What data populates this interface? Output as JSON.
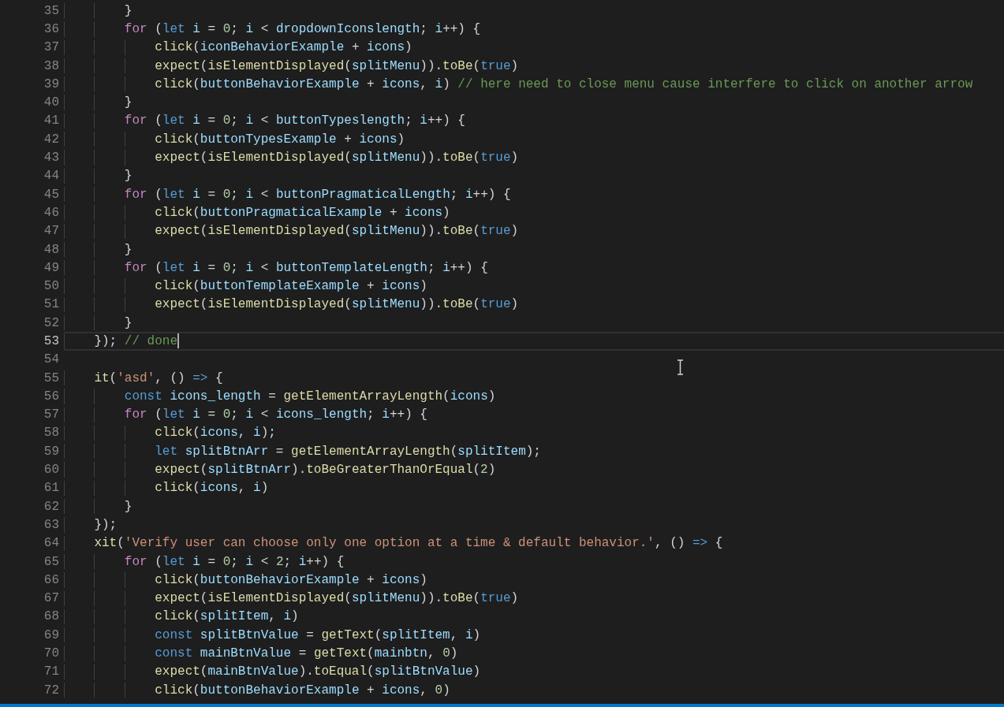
{
  "editor": {
    "lines": [
      {
        "number": "35",
        "current": false,
        "tokens": [
          {
            "kind": "plain",
            "text": "        }"
          }
        ]
      },
      {
        "number": "36",
        "current": false,
        "tokens": [
          {
            "kind": "control",
            "text": "        for"
          },
          {
            "kind": "plain",
            "text": " ("
          },
          {
            "kind": "keyword",
            "text": "let"
          },
          {
            "kind": "variable",
            "text": " i"
          },
          {
            "kind": "plain",
            "text": " = "
          },
          {
            "kind": "number",
            "text": "0"
          },
          {
            "kind": "plain",
            "text": "; "
          },
          {
            "kind": "variable",
            "text": "i"
          },
          {
            "kind": "plain",
            "text": " < "
          },
          {
            "kind": "variable",
            "text": "dropdownIconslength"
          },
          {
            "kind": "plain",
            "text": "; "
          },
          {
            "kind": "variable",
            "text": "i"
          },
          {
            "kind": "plain",
            "text": "++) {"
          }
        ]
      },
      {
        "number": "37",
        "current": false,
        "tokens": [
          {
            "kind": "function",
            "text": "            click"
          },
          {
            "kind": "plain",
            "text": "("
          },
          {
            "kind": "variable",
            "text": "iconBehaviorExample"
          },
          {
            "kind": "plain",
            "text": " + "
          },
          {
            "kind": "variable",
            "text": "icons"
          },
          {
            "kind": "plain",
            "text": ")"
          }
        ]
      },
      {
        "number": "38",
        "current": false,
        "tokens": [
          {
            "kind": "function",
            "text": "            expect"
          },
          {
            "kind": "plain",
            "text": "("
          },
          {
            "kind": "function",
            "text": "isElementDisplayed"
          },
          {
            "kind": "plain",
            "text": "("
          },
          {
            "kind": "variable",
            "text": "splitMenu"
          },
          {
            "kind": "plain",
            "text": "))."
          },
          {
            "kind": "function",
            "text": "toBe"
          },
          {
            "kind": "plain",
            "text": "("
          },
          {
            "kind": "keyword",
            "text": "true"
          },
          {
            "kind": "plain",
            "text": ")"
          }
        ]
      },
      {
        "number": "39",
        "current": false,
        "tokens": [
          {
            "kind": "function",
            "text": "            click"
          },
          {
            "kind": "plain",
            "text": "("
          },
          {
            "kind": "variable",
            "text": "buttonBehaviorExample"
          },
          {
            "kind": "plain",
            "text": " + "
          },
          {
            "kind": "variable",
            "text": "icons"
          },
          {
            "kind": "plain",
            "text": ", "
          },
          {
            "kind": "variable",
            "text": "i"
          },
          {
            "kind": "plain",
            "text": ") "
          },
          {
            "kind": "comment",
            "text": "// here need to close menu cause interfere to click on another arrow"
          }
        ]
      },
      {
        "number": "40",
        "current": false,
        "tokens": [
          {
            "kind": "plain",
            "text": "        }"
          }
        ]
      },
      {
        "number": "41",
        "current": false,
        "tokens": [
          {
            "kind": "control",
            "text": "        for"
          },
          {
            "kind": "plain",
            "text": " ("
          },
          {
            "kind": "keyword",
            "text": "let"
          },
          {
            "kind": "variable",
            "text": " i"
          },
          {
            "kind": "plain",
            "text": " = "
          },
          {
            "kind": "number",
            "text": "0"
          },
          {
            "kind": "plain",
            "text": "; "
          },
          {
            "kind": "variable",
            "text": "i"
          },
          {
            "kind": "plain",
            "text": " < "
          },
          {
            "kind": "variable",
            "text": "buttonTypeslength"
          },
          {
            "kind": "plain",
            "text": "; "
          },
          {
            "kind": "variable",
            "text": "i"
          },
          {
            "kind": "plain",
            "text": "++) {"
          }
        ]
      },
      {
        "number": "42",
        "current": false,
        "tokens": [
          {
            "kind": "function",
            "text": "            click"
          },
          {
            "kind": "plain",
            "text": "("
          },
          {
            "kind": "variable",
            "text": "buttonTypesExample"
          },
          {
            "kind": "plain",
            "text": " + "
          },
          {
            "kind": "variable",
            "text": "icons"
          },
          {
            "kind": "plain",
            "text": ")"
          }
        ]
      },
      {
        "number": "43",
        "current": false,
        "tokens": [
          {
            "kind": "function",
            "text": "            expect"
          },
          {
            "kind": "plain",
            "text": "("
          },
          {
            "kind": "function",
            "text": "isElementDisplayed"
          },
          {
            "kind": "plain",
            "text": "("
          },
          {
            "kind": "variable",
            "text": "splitMenu"
          },
          {
            "kind": "plain",
            "text": "))."
          },
          {
            "kind": "function",
            "text": "toBe"
          },
          {
            "kind": "plain",
            "text": "("
          },
          {
            "kind": "keyword",
            "text": "true"
          },
          {
            "kind": "plain",
            "text": ")"
          }
        ]
      },
      {
        "number": "44",
        "current": false,
        "tokens": [
          {
            "kind": "plain",
            "text": "        }"
          }
        ]
      },
      {
        "number": "45",
        "current": false,
        "tokens": [
          {
            "kind": "control",
            "text": "        for"
          },
          {
            "kind": "plain",
            "text": " ("
          },
          {
            "kind": "keyword",
            "text": "let"
          },
          {
            "kind": "variable",
            "text": " i"
          },
          {
            "kind": "plain",
            "text": " = "
          },
          {
            "kind": "number",
            "text": "0"
          },
          {
            "kind": "plain",
            "text": "; "
          },
          {
            "kind": "variable",
            "text": "i"
          },
          {
            "kind": "plain",
            "text": " < "
          },
          {
            "kind": "variable",
            "text": "buttonPragmaticalLength"
          },
          {
            "kind": "plain",
            "text": "; "
          },
          {
            "kind": "variable",
            "text": "i"
          },
          {
            "kind": "plain",
            "text": "++) {"
          }
        ]
      },
      {
        "number": "46",
        "current": false,
        "tokens": [
          {
            "kind": "function",
            "text": "            click"
          },
          {
            "kind": "plain",
            "text": "("
          },
          {
            "kind": "variable",
            "text": "buttonPragmaticalExample"
          },
          {
            "kind": "plain",
            "text": " + "
          },
          {
            "kind": "variable",
            "text": "icons"
          },
          {
            "kind": "plain",
            "text": ")"
          }
        ]
      },
      {
        "number": "47",
        "current": false,
        "tokens": [
          {
            "kind": "function",
            "text": "            expect"
          },
          {
            "kind": "plain",
            "text": "("
          },
          {
            "kind": "function",
            "text": "isElementDisplayed"
          },
          {
            "kind": "plain",
            "text": "("
          },
          {
            "kind": "variable",
            "text": "splitMenu"
          },
          {
            "kind": "plain",
            "text": "))."
          },
          {
            "kind": "function",
            "text": "toBe"
          },
          {
            "kind": "plain",
            "text": "("
          },
          {
            "kind": "keyword",
            "text": "true"
          },
          {
            "kind": "plain",
            "text": ")"
          }
        ]
      },
      {
        "number": "48",
        "current": false,
        "tokens": [
          {
            "kind": "plain",
            "text": "        }"
          }
        ]
      },
      {
        "number": "49",
        "current": false,
        "tokens": [
          {
            "kind": "control",
            "text": "        for"
          },
          {
            "kind": "plain",
            "text": " ("
          },
          {
            "kind": "keyword",
            "text": "let"
          },
          {
            "kind": "variable",
            "text": " i"
          },
          {
            "kind": "plain",
            "text": " = "
          },
          {
            "kind": "number",
            "text": "0"
          },
          {
            "kind": "plain",
            "text": "; "
          },
          {
            "kind": "variable",
            "text": "i"
          },
          {
            "kind": "plain",
            "text": " < "
          },
          {
            "kind": "variable",
            "text": "buttonTemplateLength"
          },
          {
            "kind": "plain",
            "text": "; "
          },
          {
            "kind": "variable",
            "text": "i"
          },
          {
            "kind": "plain",
            "text": "++) {"
          }
        ]
      },
      {
        "number": "50",
        "current": false,
        "tokens": [
          {
            "kind": "function",
            "text": "            click"
          },
          {
            "kind": "plain",
            "text": "("
          },
          {
            "kind": "variable",
            "text": "buttonTemplateExample"
          },
          {
            "kind": "plain",
            "text": " + "
          },
          {
            "kind": "variable",
            "text": "icons"
          },
          {
            "kind": "plain",
            "text": ")"
          }
        ]
      },
      {
        "number": "51",
        "current": false,
        "tokens": [
          {
            "kind": "function",
            "text": "            expect"
          },
          {
            "kind": "plain",
            "text": "("
          },
          {
            "kind": "function",
            "text": "isElementDisplayed"
          },
          {
            "kind": "plain",
            "text": "("
          },
          {
            "kind": "variable",
            "text": "splitMenu"
          },
          {
            "kind": "plain",
            "text": "))."
          },
          {
            "kind": "function",
            "text": "toBe"
          },
          {
            "kind": "plain",
            "text": "("
          },
          {
            "kind": "keyword",
            "text": "true"
          },
          {
            "kind": "plain",
            "text": ")"
          }
        ]
      },
      {
        "number": "52",
        "current": false,
        "tokens": [
          {
            "kind": "plain",
            "text": "        }"
          }
        ]
      },
      {
        "number": "53",
        "current": true,
        "tokens": [
          {
            "kind": "plain",
            "text": "    }); "
          },
          {
            "kind": "comment",
            "text": "// done"
          }
        ]
      },
      {
        "number": "54",
        "current": false
      },
      {
        "number": "55",
        "current": false,
        "tokens": [
          {
            "kind": "function",
            "text": "    it"
          },
          {
            "kind": "plain",
            "text": "("
          },
          {
            "kind": "string",
            "text": "'asd'"
          },
          {
            "kind": "plain",
            "text": ", () "
          },
          {
            "kind": "keyword",
            "text": "=>"
          },
          {
            "kind": "plain",
            "text": " {"
          }
        ]
      },
      {
        "number": "56",
        "current": false,
        "tokens": [
          {
            "kind": "keyword",
            "text": "        const"
          },
          {
            "kind": "variable",
            "text": " icons_length"
          },
          {
            "kind": "plain",
            "text": " = "
          },
          {
            "kind": "function",
            "text": "getElementArrayLength"
          },
          {
            "kind": "plain",
            "text": "("
          },
          {
            "kind": "variable",
            "text": "icons"
          },
          {
            "kind": "plain",
            "text": ")"
          }
        ]
      },
      {
        "number": "57",
        "current": false,
        "tokens": [
          {
            "kind": "control",
            "text": "        for"
          },
          {
            "kind": "plain",
            "text": " ("
          },
          {
            "kind": "keyword",
            "text": "let"
          },
          {
            "kind": "variable",
            "text": " i"
          },
          {
            "kind": "plain",
            "text": " = "
          },
          {
            "kind": "number",
            "text": "0"
          },
          {
            "kind": "plain",
            "text": "; "
          },
          {
            "kind": "variable",
            "text": "i"
          },
          {
            "kind": "plain",
            "text": " < "
          },
          {
            "kind": "variable",
            "text": "icons_length"
          },
          {
            "kind": "plain",
            "text": "; "
          },
          {
            "kind": "variable",
            "text": "i"
          },
          {
            "kind": "plain",
            "text": "++) {"
          }
        ]
      },
      {
        "number": "58",
        "current": false,
        "tokens": [
          {
            "kind": "function",
            "text": "            click"
          },
          {
            "kind": "plain",
            "text": "("
          },
          {
            "kind": "variable",
            "text": "icons"
          },
          {
            "kind": "plain",
            "text": ", "
          },
          {
            "kind": "variable",
            "text": "i"
          },
          {
            "kind": "plain",
            "text": ");"
          }
        ]
      },
      {
        "number": "59",
        "current": false,
        "tokens": [
          {
            "kind": "keyword",
            "text": "            let"
          },
          {
            "kind": "variable",
            "text": " splitBtnArr"
          },
          {
            "kind": "plain",
            "text": " = "
          },
          {
            "kind": "function",
            "text": "getElementArrayLength"
          },
          {
            "kind": "plain",
            "text": "("
          },
          {
            "kind": "variable",
            "text": "splitItem"
          },
          {
            "kind": "plain",
            "text": ");"
          }
        ]
      },
      {
        "number": "60",
        "current": false,
        "tokens": [
          {
            "kind": "function",
            "text": "            expect"
          },
          {
            "kind": "plain",
            "text": "("
          },
          {
            "kind": "variable",
            "text": "splitBtnArr"
          },
          {
            "kind": "plain",
            "text": ")."
          },
          {
            "kind": "function",
            "text": "toBeGreaterThanOrEqual"
          },
          {
            "kind": "plain",
            "text": "("
          },
          {
            "kind": "number",
            "text": "2"
          },
          {
            "kind": "plain",
            "text": ")"
          }
        ]
      },
      {
        "number": "61",
        "current": false,
        "tokens": [
          {
            "kind": "function",
            "text": "            click"
          },
          {
            "kind": "plain",
            "text": "("
          },
          {
            "kind": "variable",
            "text": "icons"
          },
          {
            "kind": "plain",
            "text": ", "
          },
          {
            "kind": "variable",
            "text": "i"
          },
          {
            "kind": "plain",
            "text": ")"
          }
        ]
      },
      {
        "number": "62",
        "current": false,
        "tokens": [
          {
            "kind": "plain",
            "text": "        }"
          }
        ]
      },
      {
        "number": "63",
        "current": false,
        "tokens": [
          {
            "kind": "plain",
            "text": "    });"
          }
        ]
      },
      {
        "number": "64",
        "current": false,
        "tokens": [
          {
            "kind": "function",
            "text": "    xit"
          },
          {
            "kind": "plain",
            "text": "("
          },
          {
            "kind": "string",
            "text": "'Verify user can choose only one option at a time & default behavior.'"
          },
          {
            "kind": "plain",
            "text": ", () "
          },
          {
            "kind": "keyword",
            "text": "=>"
          },
          {
            "kind": "plain",
            "text": " {"
          }
        ]
      },
      {
        "number": "65",
        "current": false,
        "tokens": [
          {
            "kind": "control",
            "text": "        for"
          },
          {
            "kind": "plain",
            "text": " ("
          },
          {
            "kind": "keyword",
            "text": "let"
          },
          {
            "kind": "variable",
            "text": " i"
          },
          {
            "kind": "plain",
            "text": " = "
          },
          {
            "kind": "number",
            "text": "0"
          },
          {
            "kind": "plain",
            "text": "; "
          },
          {
            "kind": "variable",
            "text": "i"
          },
          {
            "kind": "plain",
            "text": " < "
          },
          {
            "kind": "number",
            "text": "2"
          },
          {
            "kind": "plain",
            "text": "; "
          },
          {
            "kind": "variable",
            "text": "i"
          },
          {
            "kind": "plain",
            "text": "++) {"
          }
        ]
      },
      {
        "number": "66",
        "current": false,
        "tokens": [
          {
            "kind": "function",
            "text": "            click"
          },
          {
            "kind": "plain",
            "text": "("
          },
          {
            "kind": "variable",
            "text": "buttonBehaviorExample"
          },
          {
            "kind": "plain",
            "text": " + "
          },
          {
            "kind": "variable",
            "text": "icons"
          },
          {
            "kind": "plain",
            "text": ")"
          }
        ]
      },
      {
        "number": "67",
        "current": false,
        "tokens": [
          {
            "kind": "function",
            "text": "            expect"
          },
          {
            "kind": "plain",
            "text": "("
          },
          {
            "kind": "function",
            "text": "isElementDisplayed"
          },
          {
            "kind": "plain",
            "text": "("
          },
          {
            "kind": "variable",
            "text": "splitMenu"
          },
          {
            "kind": "plain",
            "text": "))."
          },
          {
            "kind": "function",
            "text": "toBe"
          },
          {
            "kind": "plain",
            "text": "("
          },
          {
            "kind": "keyword",
            "text": "true"
          },
          {
            "kind": "plain",
            "text": ")"
          }
        ]
      },
      {
        "number": "68",
        "current": false,
        "tokens": [
          {
            "kind": "function",
            "text": "            click"
          },
          {
            "kind": "plain",
            "text": "("
          },
          {
            "kind": "variable",
            "text": "splitItem"
          },
          {
            "kind": "plain",
            "text": ", "
          },
          {
            "kind": "variable",
            "text": "i"
          },
          {
            "kind": "plain",
            "text": ")"
          }
        ]
      },
      {
        "number": "69",
        "current": false,
        "tokens": [
          {
            "kind": "keyword",
            "text": "            const"
          },
          {
            "kind": "variable",
            "text": " splitBtnValue"
          },
          {
            "kind": "plain",
            "text": " = "
          },
          {
            "kind": "function",
            "text": "getText"
          },
          {
            "kind": "plain",
            "text": "("
          },
          {
            "kind": "variable",
            "text": "splitItem"
          },
          {
            "kind": "plain",
            "text": ", "
          },
          {
            "kind": "variable",
            "text": "i"
          },
          {
            "kind": "plain",
            "text": ")"
          }
        ]
      },
      {
        "number": "70",
        "current": false,
        "tokens": [
          {
            "kind": "keyword",
            "text": "            const"
          },
          {
            "kind": "variable",
            "text": " mainBtnValue"
          },
          {
            "kind": "plain",
            "text": " = "
          },
          {
            "kind": "function",
            "text": "getText"
          },
          {
            "kind": "plain",
            "text": "("
          },
          {
            "kind": "variable",
            "text": "mainbtn"
          },
          {
            "kind": "plain",
            "text": ", "
          },
          {
            "kind": "number",
            "text": "0"
          },
          {
            "kind": "plain",
            "text": ")"
          }
        ]
      },
      {
        "number": "71",
        "current": false,
        "tokens": [
          {
            "kind": "function",
            "text": "            expect"
          },
          {
            "kind": "plain",
            "text": "("
          },
          {
            "kind": "variable",
            "text": "mainBtnValue"
          },
          {
            "kind": "plain",
            "text": ")."
          },
          {
            "kind": "function",
            "text": "toEqual"
          },
          {
            "kind": "plain",
            "text": "("
          },
          {
            "kind": "variable",
            "text": "splitBtnValue"
          },
          {
            "kind": "plain",
            "text": ")"
          }
        ]
      },
      {
        "number": "72",
        "current": false,
        "tokens": [
          {
            "kind": "function",
            "text": "            click"
          },
          {
            "kind": "plain",
            "text": "("
          },
          {
            "kind": "variable",
            "text": "buttonBehaviorExample"
          },
          {
            "kind": "plain",
            "text": " + "
          },
          {
            "kind": "variable",
            "text": "icons"
          },
          {
            "kind": "plain",
            "text": ", "
          },
          {
            "kind": "number",
            "text": "0"
          },
          {
            "kind": "plain",
            "text": ")"
          }
        ]
      }
    ]
  }
}
